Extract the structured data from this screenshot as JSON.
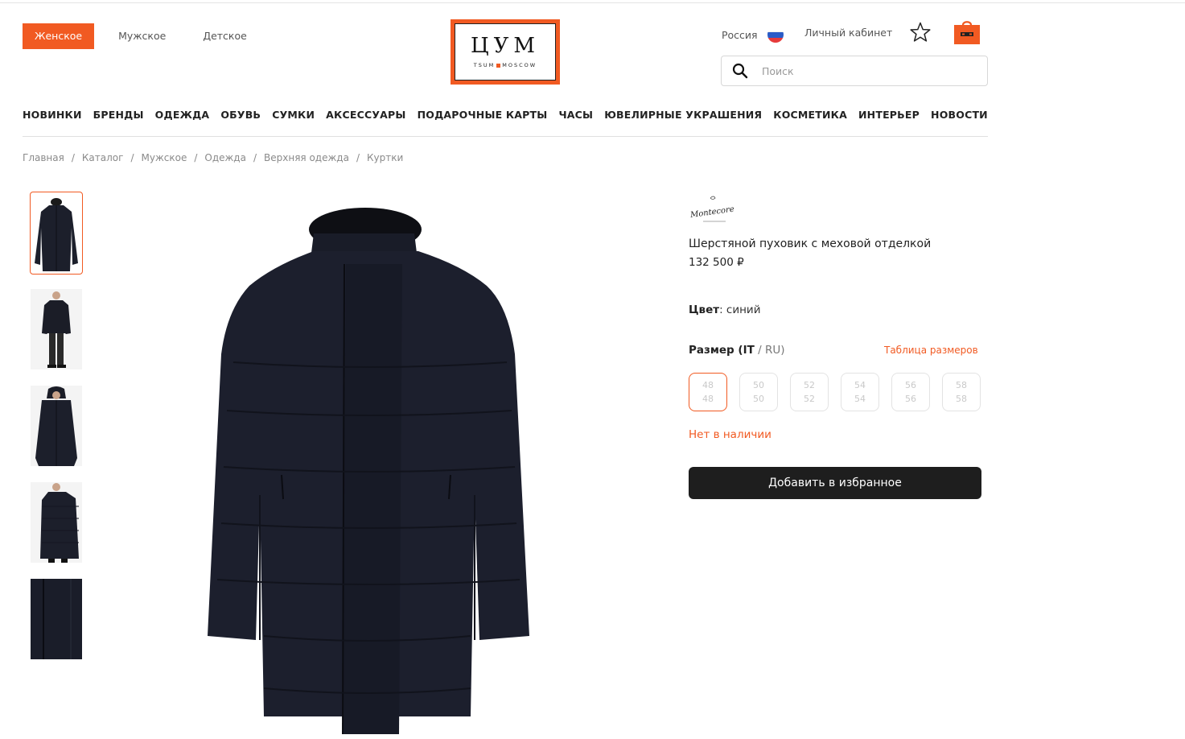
{
  "header": {
    "gender_tabs": [
      "Женское",
      "Мужское",
      "Детское"
    ],
    "logo": {
      "letters": "ЦУМ",
      "sub_left": "TSUM",
      "sub_right": "MOSCOW"
    },
    "country": "Россия",
    "account": "Личный кабинет",
    "search_placeholder": "Поиск",
    "accent_color": "#f15a22"
  },
  "nav": [
    "НОВИНКИ",
    "БРЕНДЫ",
    "ОДЕЖДА",
    "ОБУВЬ",
    "СУМКИ",
    "АКСЕССУАРЫ",
    "ПОДАРОЧНЫЕ КАРТЫ",
    "ЧАСЫ",
    "ЮВЕЛИРНЫЕ УКРАШЕНИЯ",
    "КОСМЕТИКА",
    "ИНТЕРЬЕР",
    "НОВОСТИ"
  ],
  "breadcrumbs": [
    "Главная",
    "Каталог",
    "Мужское",
    "Одежда",
    "Верхняя одежда",
    "Куртки"
  ],
  "product": {
    "brand_logo": "Montecore",
    "title": "Шерстяной пуховик с меховой отделкой",
    "price": "132 500 ₽",
    "color_label": "Цвет",
    "color_value": ": синий",
    "size_label": "Размер (IT",
    "size_label_rest": " / RU)",
    "size_table": "Таблица размеров",
    "sizes": [
      {
        "it": "48",
        "ru": "48"
      },
      {
        "it": "50",
        "ru": "50"
      },
      {
        "it": "52",
        "ru": "52"
      },
      {
        "it": "54",
        "ru": "54"
      },
      {
        "it": "56",
        "ru": "56"
      },
      {
        "it": "58",
        "ru": "58"
      }
    ],
    "availability": "Нет в наличии",
    "favorite_button": "Добавить в избранное"
  }
}
